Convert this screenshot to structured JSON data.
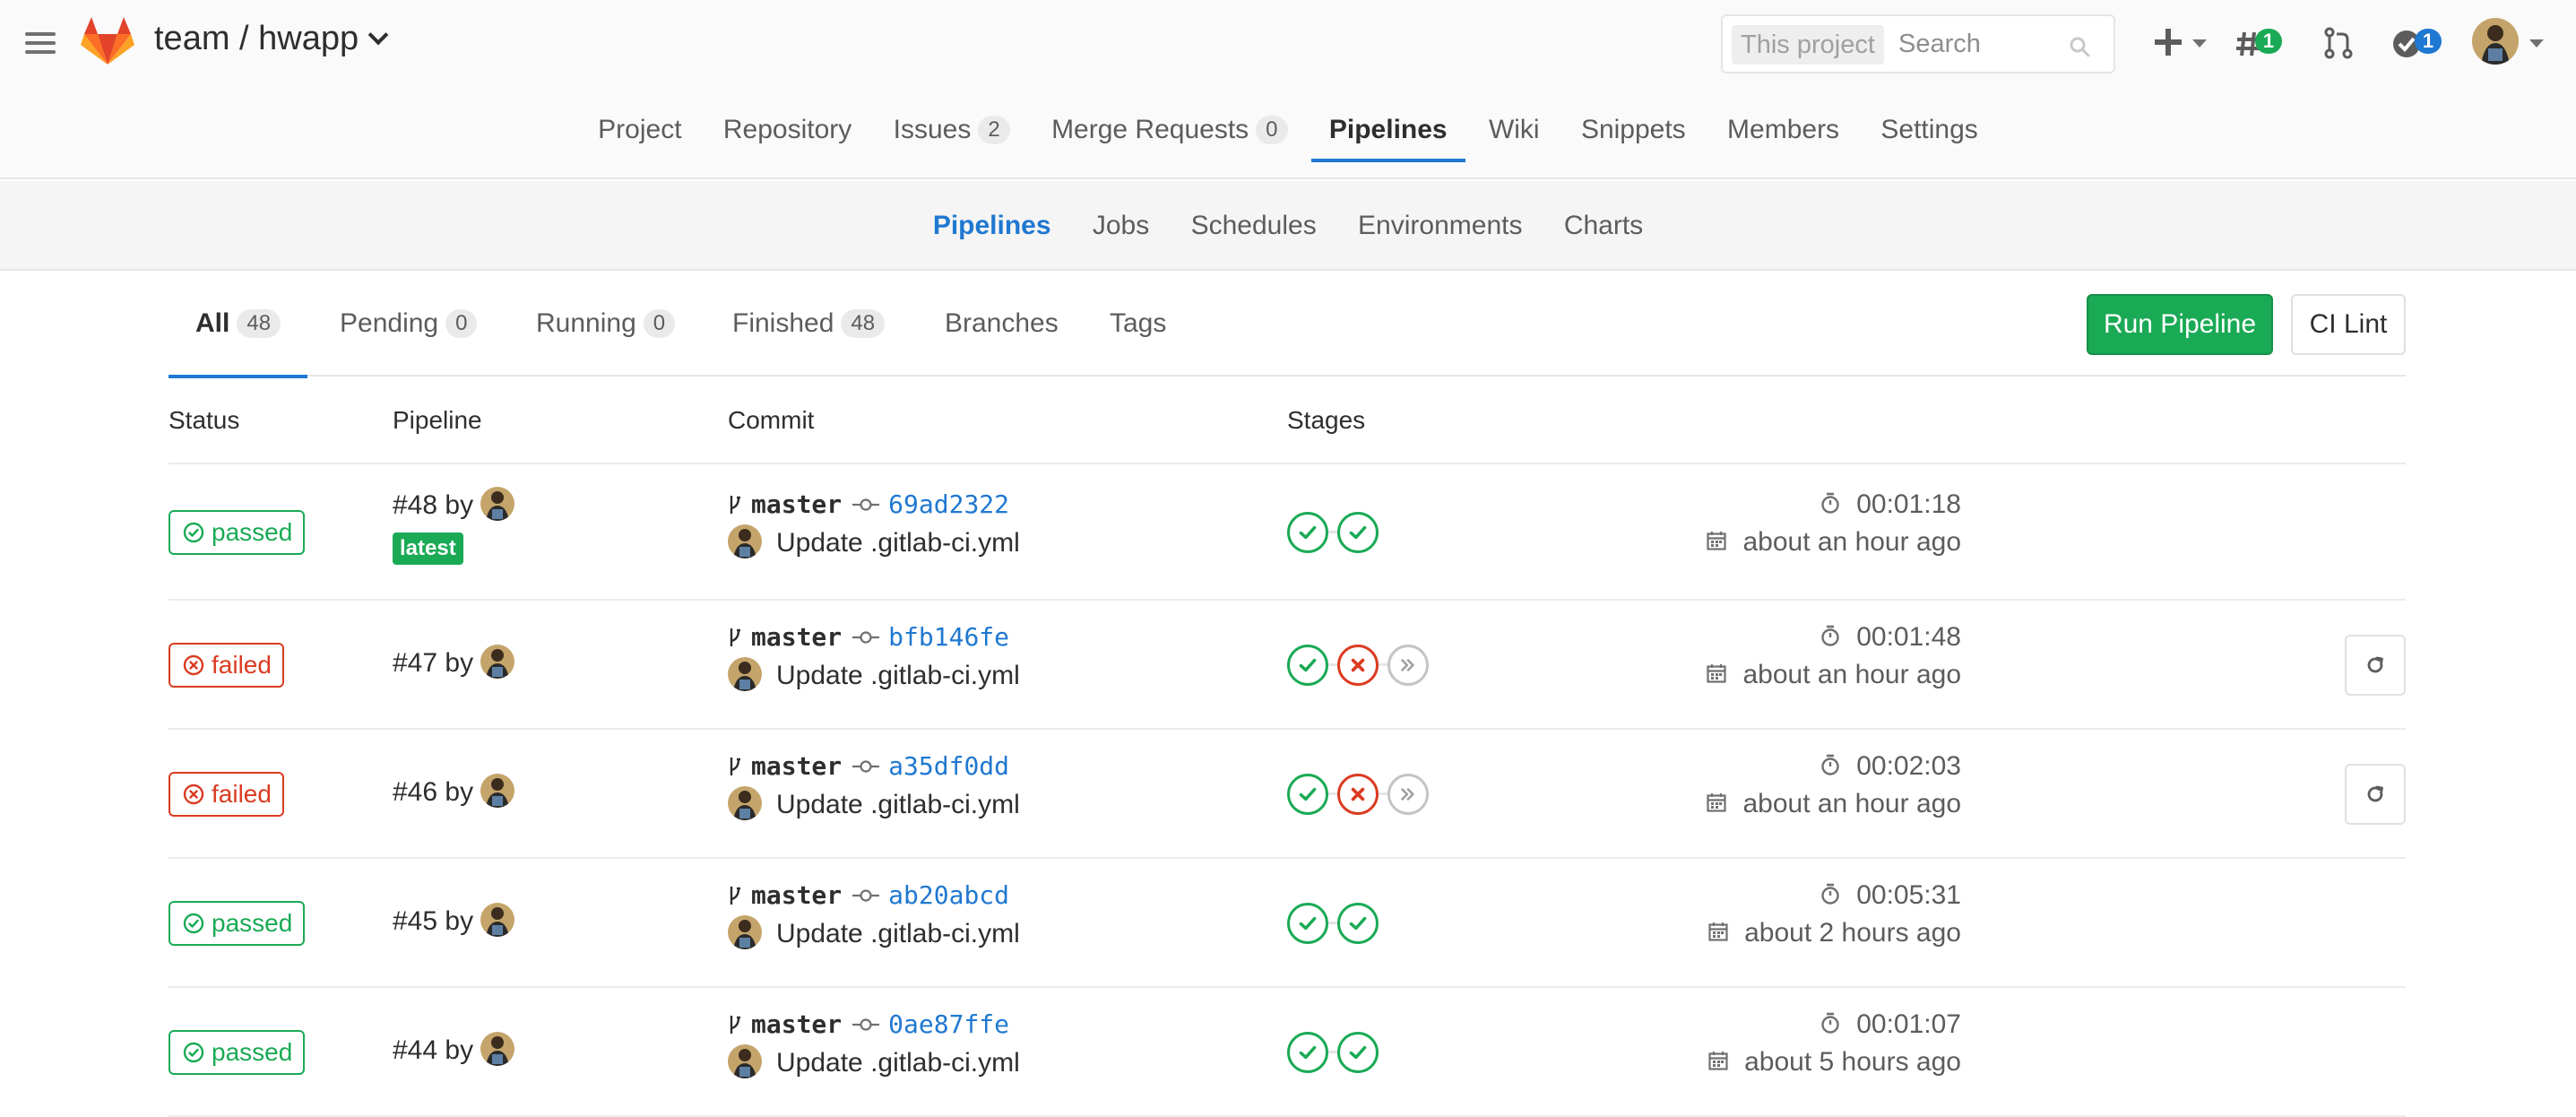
{
  "header": {
    "group": "team",
    "separator": "/",
    "project": "hwapp",
    "search_scope": "This project",
    "search_placeholder": "Search",
    "issues_badge": "1",
    "todos_badge": "1"
  },
  "main_nav": [
    {
      "label": "Project"
    },
    {
      "label": "Repository"
    },
    {
      "label": "Issues",
      "count": "2"
    },
    {
      "label": "Merge Requests",
      "count": "0"
    },
    {
      "label": "Pipelines",
      "active": true
    },
    {
      "label": "Wiki"
    },
    {
      "label": "Snippets"
    },
    {
      "label": "Members"
    },
    {
      "label": "Settings"
    }
  ],
  "sub_nav": [
    {
      "label": "Pipelines",
      "active": true
    },
    {
      "label": "Jobs"
    },
    {
      "label": "Schedules"
    },
    {
      "label": "Environments"
    },
    {
      "label": "Charts"
    }
  ],
  "tabs": [
    {
      "label": "All",
      "count": "48",
      "active": true
    },
    {
      "label": "Pending",
      "count": "0"
    },
    {
      "label": "Running",
      "count": "0"
    },
    {
      "label": "Finished",
      "count": "48"
    },
    {
      "label": "Branches"
    },
    {
      "label": "Tags"
    }
  ],
  "actions": {
    "run_pipeline": "Run Pipeline",
    "ci_lint": "CI Lint"
  },
  "table": {
    "headers": {
      "status": "Status",
      "pipeline": "Pipeline",
      "commit": "Commit",
      "stages": "Stages"
    },
    "rows": [
      {
        "status": "passed",
        "pipeline": "#48",
        "by": "by",
        "latest": "latest",
        "branch": "master",
        "sha": "69ad2322",
        "message": "Update .gitlab-ci.yml",
        "stages": [
          "success",
          "success"
        ],
        "duration": "00:01:18",
        "finished": "about an hour ago",
        "retry": false
      },
      {
        "status": "failed",
        "pipeline": "#47",
        "by": "by",
        "branch": "master",
        "sha": "bfb146fe",
        "message": "Update .gitlab-ci.yml",
        "stages": [
          "success",
          "failed",
          "skipped"
        ],
        "duration": "00:01:48",
        "finished": "about an hour ago",
        "retry": true
      },
      {
        "status": "failed",
        "pipeline": "#46",
        "by": "by",
        "branch": "master",
        "sha": "a35df0dd",
        "message": "Update .gitlab-ci.yml",
        "stages": [
          "success",
          "failed",
          "skipped"
        ],
        "duration": "00:02:03",
        "finished": "about an hour ago",
        "retry": true
      },
      {
        "status": "passed",
        "pipeline": "#45",
        "by": "by",
        "branch": "master",
        "sha": "ab20abcd",
        "message": "Update .gitlab-ci.yml",
        "stages": [
          "success",
          "success"
        ],
        "duration": "00:05:31",
        "finished": "about 2 hours ago",
        "retry": false
      },
      {
        "status": "passed",
        "pipeline": "#44",
        "by": "by",
        "branch": "master",
        "sha": "0ae87ffe",
        "message": "Update .gitlab-ci.yml",
        "stages": [
          "success",
          "success"
        ],
        "duration": "00:01:07",
        "finished": "about 5 hours ago",
        "retry": false
      }
    ]
  },
  "colors": {
    "success": "#1aaa55",
    "failed": "#db3b21",
    "link": "#1f78d1",
    "skipped": "#c4c4c4"
  }
}
